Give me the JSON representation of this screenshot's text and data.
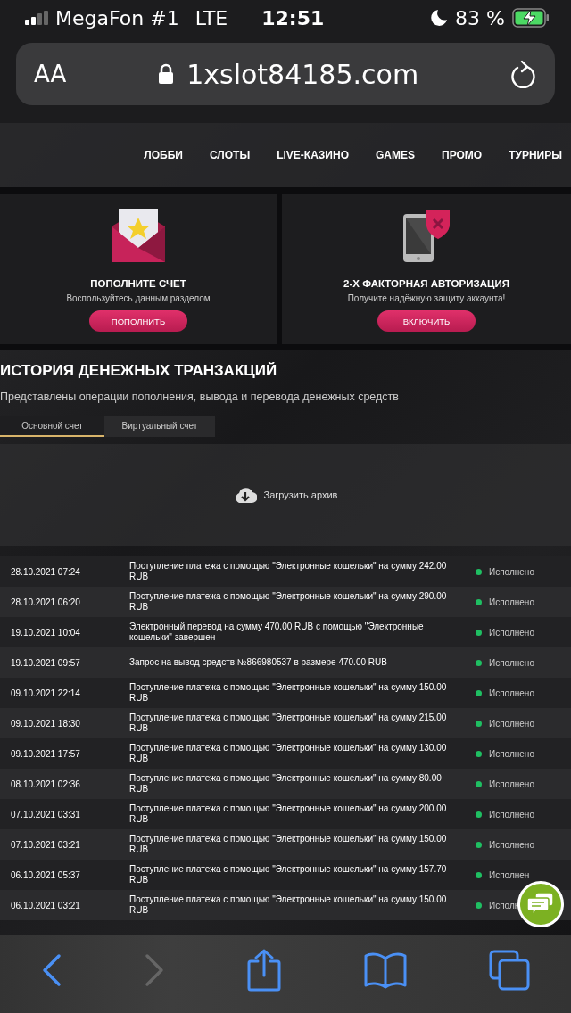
{
  "status_bar": {
    "carrier": "MegaFon #1",
    "network": "LTE",
    "time": "12:51",
    "battery": "83 %"
  },
  "address_bar": {
    "text_size": "AA",
    "url": "1xslot84185.com"
  },
  "nav": [
    {
      "label": "ЛОББИ"
    },
    {
      "label": "СЛОТЫ"
    },
    {
      "label": "LIVE-КАЗИНО"
    },
    {
      "label": "GAMES"
    },
    {
      "label": "ПРОМО"
    },
    {
      "label": "ТУРНИРЫ"
    }
  ],
  "cards": [
    {
      "kind": "deposit",
      "title": "ПОПОЛНИТЕ СЧЕТ",
      "text": "Воспользуйтесь данным разделом",
      "button": "ПОПОЛНИТЬ"
    },
    {
      "kind": "security",
      "title": "2-Х ФАКТОРНАЯ АВТОРИЗАЦИЯ",
      "text": "Получите надёжную защиту аккаунта!",
      "button": "ВКЛЮЧИТЬ"
    }
  ],
  "history": {
    "title": "ИСТОРИЯ ДЕНЕЖНЫХ ТРАНЗАКЦИЙ",
    "subtitle": "Представлены операции пополнения, вывода и перевода денежных средств",
    "tabs": [
      {
        "label": "Основной счет",
        "selected": true
      },
      {
        "label": "Виртуальный счет",
        "selected": false
      }
    ],
    "archive_button": "Загрузить архив",
    "rows": [
      {
        "date": "28.10.2021 07:24",
        "description": "Поступление платежа с помощью \"Электронные кошельки\" на сумму 242.00 RUB",
        "status": "Исполнено"
      },
      {
        "date": "28.10.2021 06:20",
        "description": "Поступление платежа с помощью \"Электронные кошельки\" на сумму 290.00 RUB",
        "status": "Исполнено"
      },
      {
        "date": "19.10.2021 10:04",
        "description": "Электронный перевод на сумму 470.00 RUB с помощью \"Электронные кошельки\" завершен",
        "status": "Исполнено"
      },
      {
        "date": "19.10.2021 09:57",
        "description": "Запрос на вывод средств №866980537 в размере 470.00 RUB",
        "status": "Исполнено"
      },
      {
        "date": "09.10.2021 22:14",
        "description": "Поступление платежа с помощью \"Электронные кошельки\" на сумму 150.00 RUB",
        "status": "Исполнено"
      },
      {
        "date": "09.10.2021 18:30",
        "description": "Поступление платежа с помощью \"Электронные кошельки\" на сумму 215.00 RUB",
        "status": "Исполнено"
      },
      {
        "date": "09.10.2021 17:57",
        "description": "Поступление платежа с помощью \"Электронные кошельки\" на сумму 130.00 RUB",
        "status": "Исполнено"
      },
      {
        "date": "08.10.2021 02:36",
        "description": "Поступление платежа с помощью \"Электронные кошельки\" на сумму 80.00 RUB",
        "status": "Исполнено"
      },
      {
        "date": "07.10.2021 03:31",
        "description": "Поступление платежа с помощью \"Электронные кошельки\" на сумму 200.00 RUB",
        "status": "Исполнено"
      },
      {
        "date": "07.10.2021 03:21",
        "description": "Поступление платежа с помощью \"Электронные кошельки\" на сумму 150.00 RUB",
        "status": "Исполнено"
      },
      {
        "date": "06.10.2021 05:37",
        "description": "Поступление платежа с помощью \"Электронные кошельки\" на сумму 157.70 RUB",
        "status": "Исполнен"
      },
      {
        "date": "06.10.2021 03:21",
        "description": "Поступление платежа с помощью \"Электронные кошельки\" на сумму 150.00 RUB",
        "status": "Исполн"
      }
    ]
  }
}
